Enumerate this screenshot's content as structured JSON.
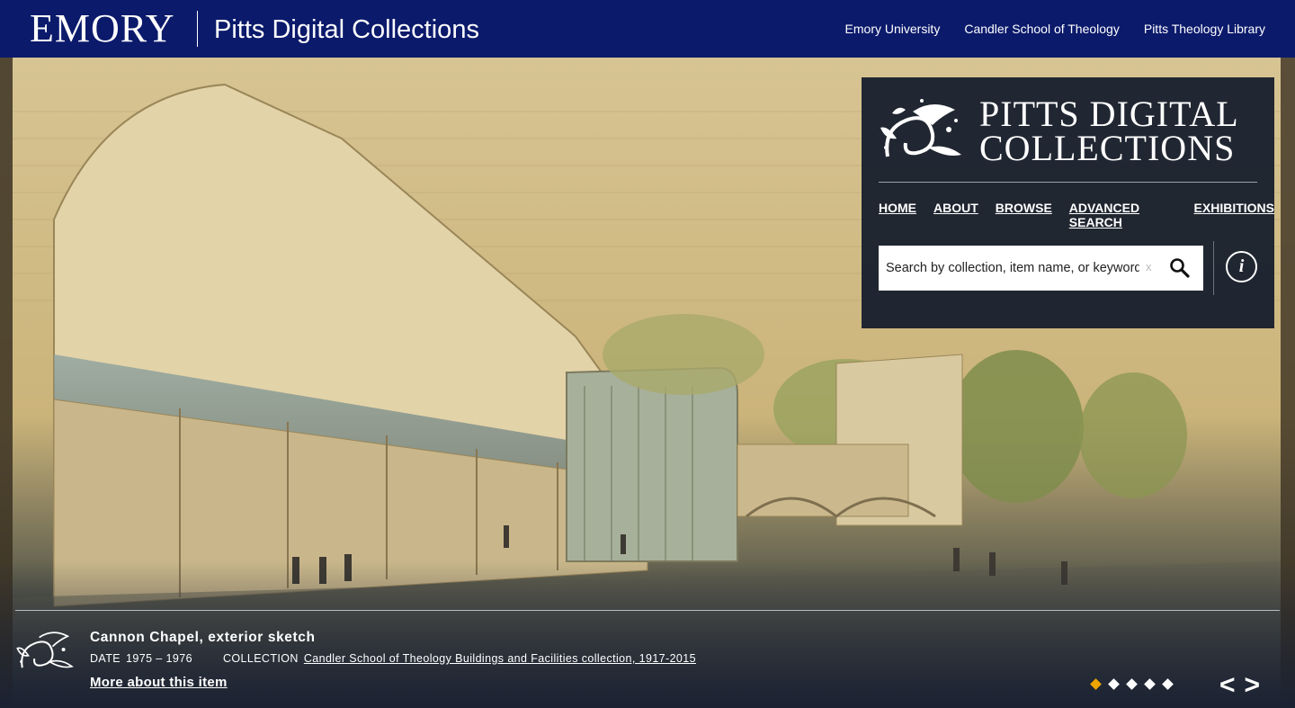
{
  "topbar": {
    "brand": "EMORY",
    "site_title": "Pitts Digital Collections",
    "links": [
      "Emory University",
      "Candler School of Theology",
      "Pitts Theology Library"
    ]
  },
  "panel": {
    "logo_line1": "PITTS DIGITAL",
    "logo_line2": "COLLECTIONS",
    "nav": [
      "HOME",
      "ABOUT",
      "BROWSE",
      "ADVANCED SEARCH",
      "EXHIBITIONS"
    ],
    "search_placeholder": "Search by collection, item name, or keyword",
    "clear_label": "x",
    "info_label": "i"
  },
  "caption": {
    "title": "Cannon Chapel, exterior sketch",
    "date_label": "DATE",
    "date_value": "1975 – 1976",
    "collection_label": "COLLECTION",
    "collection_value": "Candler School of Theology Buildings and Facilities collection, 1917-2015",
    "more_link": "More about this item"
  },
  "carousel": {
    "slide_count": 5,
    "active_index": 0,
    "prev_label": "<",
    "next_label": ">"
  },
  "colors": {
    "topbar_bg": "#0b1a6b",
    "panel_bg": "#19202e",
    "active_dot": "#f0a500"
  },
  "icons": [
    "search-icon",
    "info-icon",
    "clear-icon",
    "leaf-bird-logo-icon"
  ]
}
